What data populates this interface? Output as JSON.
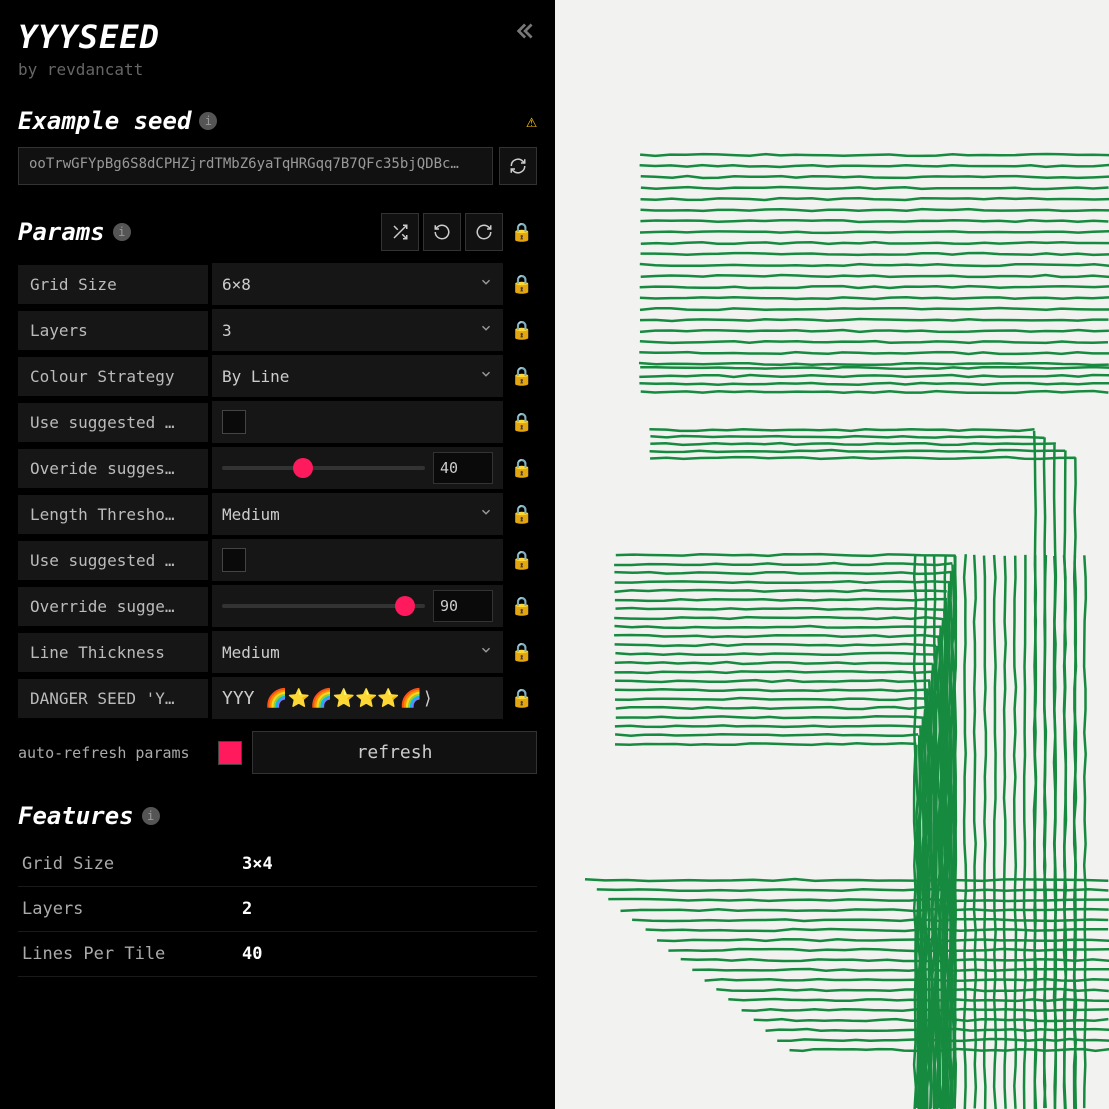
{
  "header": {
    "title": "YYYSEED",
    "author_prefix": "by ",
    "author": "revdancatt"
  },
  "seed": {
    "section_title": "Example seed",
    "value": "ooTrwGFYpBg6S8dCPHZjrdTMbZ6yaTqHRGqq7B7QFc35bjQDBc…"
  },
  "params": {
    "section_title": "Params",
    "rows": [
      {
        "label": "Grid Size",
        "type": "select",
        "value": "6×8"
      },
      {
        "label": "Layers",
        "type": "select",
        "value": "3"
      },
      {
        "label": "Colour Strategy",
        "type": "select",
        "value": "By Line"
      },
      {
        "label": "Use suggested …",
        "type": "checkbox",
        "checked": false
      },
      {
        "label": "Overide sugges…",
        "type": "slider",
        "value": "40",
        "percent": 40
      },
      {
        "label": "Length Thresho…",
        "type": "select",
        "value": "Medium"
      },
      {
        "label": "Use suggested …",
        "type": "checkbox",
        "checked": false
      },
      {
        "label": "Override sugge…",
        "type": "slider",
        "value": "90",
        "percent": 90
      },
      {
        "label": "Line Thickness",
        "type": "select",
        "value": "Medium"
      },
      {
        "label": "DANGER SEED 'Y…",
        "type": "text",
        "value": "YYY 🌈⭐🌈⭐⭐⭐🌈⟩"
      }
    ],
    "auto_refresh_label": "auto-refresh params",
    "refresh_label": "refresh"
  },
  "features": {
    "section_title": "Features",
    "rows": [
      {
        "label": "Grid Size",
        "value": "3×4"
      },
      {
        "label": "Layers",
        "value": "2"
      },
      {
        "label": "Lines Per Tile",
        "value": "40"
      }
    ]
  },
  "colors": {
    "accent": "#ff1a5e",
    "art_stroke": "#168a3f"
  }
}
